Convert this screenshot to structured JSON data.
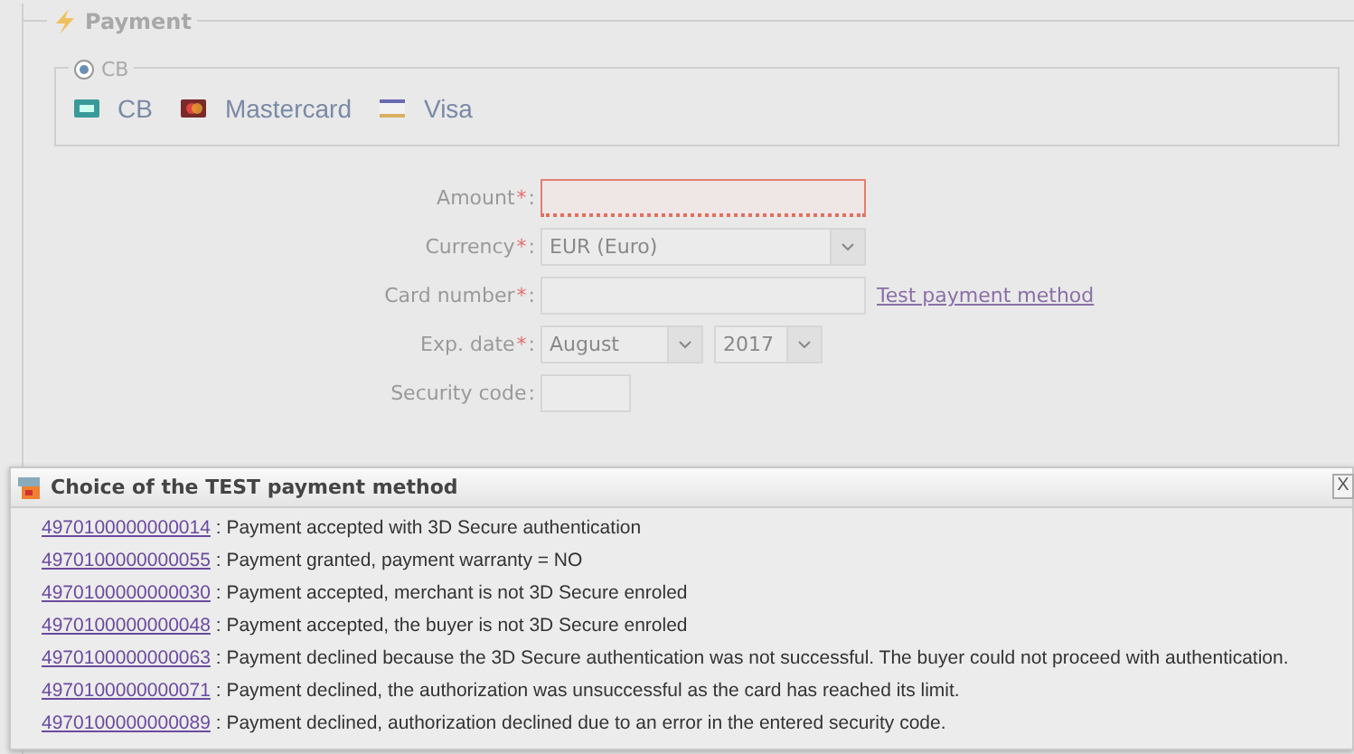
{
  "payment": {
    "legend": "Payment",
    "method_group": {
      "legend": "CB",
      "selected": true,
      "cards": [
        {
          "kind": "cb",
          "label": "CB"
        },
        {
          "kind": "mastercard",
          "label": "Mastercard"
        },
        {
          "kind": "visa",
          "label": "Visa"
        }
      ]
    },
    "fields": [
      {
        "kind": "text",
        "label": "Amount",
        "marker": "*",
        "suffix": ":",
        "invalid": true
      },
      {
        "kind": "select",
        "label": "Currency",
        "marker": "*",
        "suffix": ":",
        "invalid": false,
        "value": "EUR (Euro)"
      },
      {
        "kind": "text",
        "label": "Card number",
        "marker": "*",
        "suffix": ":",
        "invalid": false,
        "link": "Test payment method"
      },
      {
        "kind": "date",
        "label": "Exp. date",
        "marker": "*",
        "suffix": ":",
        "month": "August",
        "year": "2017"
      },
      {
        "kind": "code",
        "label": "Security code",
        "suffix": ":",
        "invalid": false
      }
    ]
  },
  "dialog": {
    "title": "Choice of the TEST payment method",
    "close": "X",
    "rows": [
      {
        "number": "4970100000000014",
        "description": ": Payment accepted with 3D Secure authentication"
      },
      {
        "number": "4970100000000055",
        "description": ": Payment granted, payment warranty = NO"
      },
      {
        "number": "4970100000000030",
        "description": ": Payment accepted, merchant is not 3D Secure enroled"
      },
      {
        "number": "4970100000000048",
        "description": ": Payment accepted, the buyer is not 3D Secure enroled"
      },
      {
        "number": "4970100000000063",
        "description": ": Payment declined because the 3D Secure authentication was not successful. The buyer could not proceed with authentication."
      },
      {
        "number": "4970100000000071",
        "description": ": Payment declined, the authorization was unsuccessful as the card has reached its limit."
      },
      {
        "number": "4970100000000089",
        "description": ": Payment declined, authorization declined due to an error in the entered security code."
      }
    ]
  }
}
